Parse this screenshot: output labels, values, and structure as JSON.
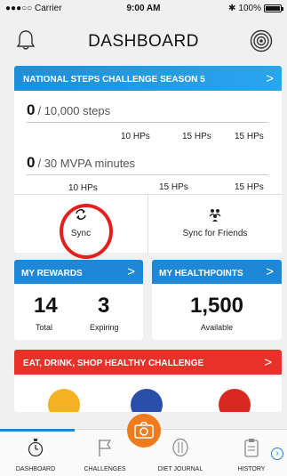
{
  "status": {
    "carrier": "●●●○○ Carrier",
    "time": "9:00 AM",
    "battery": "100%"
  },
  "header": {
    "title": "DASHBOARD"
  },
  "steps_challenge": {
    "title": "NATIONAL STEPS CHALLENGE SEASON 5",
    "steps_value": "0",
    "steps_goal": "/ 10,000 steps",
    "steps_hps": [
      "10 HPs",
      "15 HPs",
      "15 HPs"
    ],
    "mvpa_value": "0",
    "mvpa_goal": "/ 30 MVPA minutes",
    "mvpa_hps": [
      "10 HPs",
      "15 HPs",
      "15 HPs"
    ],
    "sync_label": "Sync",
    "sync_friends_label": "Sync for Friends"
  },
  "rewards": {
    "title": "MY REWARDS",
    "total_value": "14",
    "total_label": "Total",
    "expiring_value": "3",
    "expiring_label": "Expiring"
  },
  "healthpoints": {
    "title": "MY HEALTHPOINTS",
    "value": "1,500",
    "label": "Available"
  },
  "eat_challenge": {
    "title": "EAT, DRINK, SHOP HEALTHY CHALLENGE"
  },
  "tabs": [
    {
      "label": "DASHBOARD",
      "icon": "stopwatch-icon"
    },
    {
      "label": "CHALLENGES",
      "icon": "flag-icon"
    },
    {
      "label": "DIET JOURNAL",
      "icon": "cutlery-icon"
    },
    {
      "label": "HISTORY",
      "icon": "clipboard-icon"
    }
  ],
  "colors": {
    "accent_blue": "#1e88d6",
    "challenge_red": "#e83229",
    "camera_orange": "#f07b1d",
    "highlight_ring": "#e3201d"
  }
}
